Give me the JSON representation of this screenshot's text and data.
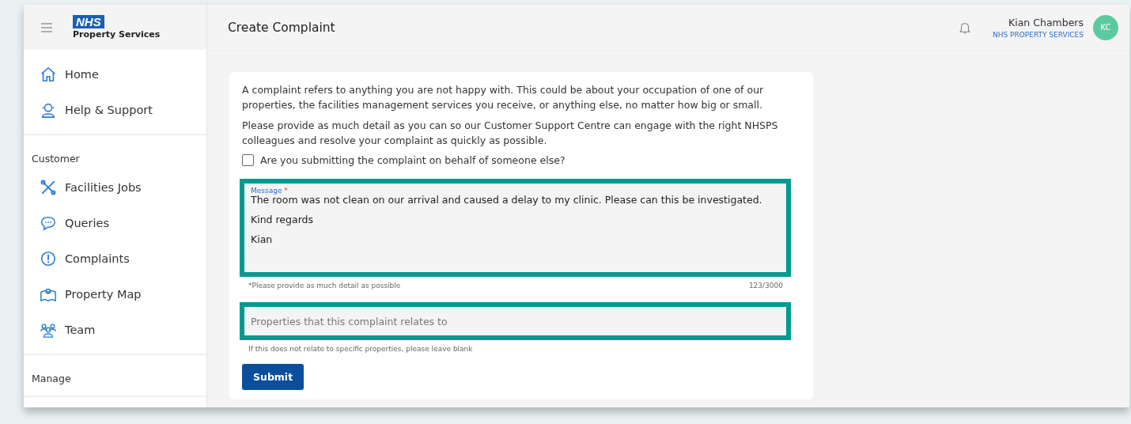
{
  "header": {
    "brand_badge": "NHS",
    "brand_name": "Property Services",
    "title": "Create Complaint",
    "user": {
      "name": "Kian Chambers",
      "organisation": "NHS PROPERTY SERVICES",
      "initials": "KC"
    }
  },
  "sidebar": {
    "sections": [
      {
        "items": [
          {
            "label": "Home",
            "kind": "home"
          },
          {
            "label": "Help & Support",
            "kind": "support"
          }
        ]
      },
      {
        "heading": "Customer",
        "items": [
          {
            "label": "Facilities Jobs",
            "kind": "tools"
          },
          {
            "label": "Queries",
            "kind": "chat"
          },
          {
            "label": "Complaints",
            "kind": "alert"
          },
          {
            "label": "Property Map",
            "kind": "map"
          },
          {
            "label": "Team",
            "kind": "team"
          }
        ]
      },
      {
        "heading": "Manage"
      }
    ]
  },
  "form": {
    "intro": [
      "A complaint refers to anything you are not happy with. This could be about your occupation of one of our properties, the facilities management services you receive, or anything else, no matter how big or small.",
      "Please provide as much detail as you can so our Customer Support Centre can engage with the right NHSPS colleagues and resolve your complaint as quickly as possible."
    ],
    "on_behalf": {
      "label": "Are you submitting the complaint on behalf of someone else?",
      "checked": false
    },
    "message": {
      "label": "Message",
      "required": "*",
      "value": [
        "The room was not clean on our arrival and caused a delay to my clinic. Please can this be investigated.",
        "Kind regards",
        "Kian"
      ],
      "helper": "*Please provide as much detail as possible",
      "counter": "123/3000"
    },
    "properties": {
      "placeholder": "Properties that this complaint relates to",
      "helper": "If this does not relate to specific properties, please leave blank"
    },
    "submit": "Submit"
  }
}
